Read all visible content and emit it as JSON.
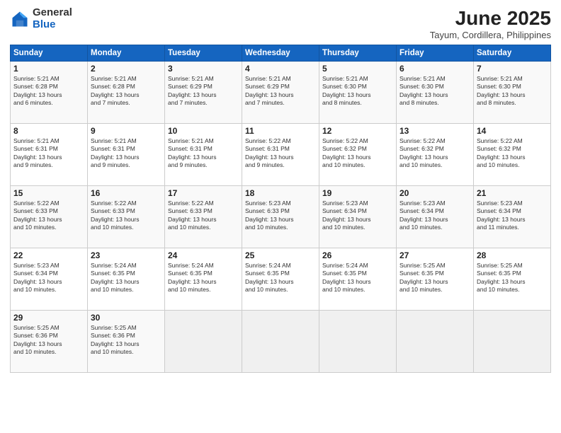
{
  "header": {
    "logo_general": "General",
    "logo_blue": "Blue",
    "title": "June 2025",
    "subtitle": "Tayum, Cordillera, Philippines"
  },
  "weekdays": [
    "Sunday",
    "Monday",
    "Tuesday",
    "Wednesday",
    "Thursday",
    "Friday",
    "Saturday"
  ],
  "weeks": [
    [
      {
        "day": "1",
        "lines": [
          "Sunrise: 5:21 AM",
          "Sunset: 6:28 PM",
          "Daylight: 13 hours",
          "and 6 minutes."
        ]
      },
      {
        "day": "2",
        "lines": [
          "Sunrise: 5:21 AM",
          "Sunset: 6:28 PM",
          "Daylight: 13 hours",
          "and 7 minutes."
        ]
      },
      {
        "day": "3",
        "lines": [
          "Sunrise: 5:21 AM",
          "Sunset: 6:29 PM",
          "Daylight: 13 hours",
          "and 7 minutes."
        ]
      },
      {
        "day": "4",
        "lines": [
          "Sunrise: 5:21 AM",
          "Sunset: 6:29 PM",
          "Daylight: 13 hours",
          "and 7 minutes."
        ]
      },
      {
        "day": "5",
        "lines": [
          "Sunrise: 5:21 AM",
          "Sunset: 6:30 PM",
          "Daylight: 13 hours",
          "and 8 minutes."
        ]
      },
      {
        "day": "6",
        "lines": [
          "Sunrise: 5:21 AM",
          "Sunset: 6:30 PM",
          "Daylight: 13 hours",
          "and 8 minutes."
        ]
      },
      {
        "day": "7",
        "lines": [
          "Sunrise: 5:21 AM",
          "Sunset: 6:30 PM",
          "Daylight: 13 hours",
          "and 8 minutes."
        ]
      }
    ],
    [
      {
        "day": "8",
        "lines": [
          "Sunrise: 5:21 AM",
          "Sunset: 6:31 PM",
          "Daylight: 13 hours",
          "and 9 minutes."
        ]
      },
      {
        "day": "9",
        "lines": [
          "Sunrise: 5:21 AM",
          "Sunset: 6:31 PM",
          "Daylight: 13 hours",
          "and 9 minutes."
        ]
      },
      {
        "day": "10",
        "lines": [
          "Sunrise: 5:21 AM",
          "Sunset: 6:31 PM",
          "Daylight: 13 hours",
          "and 9 minutes."
        ]
      },
      {
        "day": "11",
        "lines": [
          "Sunrise: 5:22 AM",
          "Sunset: 6:31 PM",
          "Daylight: 13 hours",
          "and 9 minutes."
        ]
      },
      {
        "day": "12",
        "lines": [
          "Sunrise: 5:22 AM",
          "Sunset: 6:32 PM",
          "Daylight: 13 hours",
          "and 10 minutes."
        ]
      },
      {
        "day": "13",
        "lines": [
          "Sunrise: 5:22 AM",
          "Sunset: 6:32 PM",
          "Daylight: 13 hours",
          "and 10 minutes."
        ]
      },
      {
        "day": "14",
        "lines": [
          "Sunrise: 5:22 AM",
          "Sunset: 6:32 PM",
          "Daylight: 13 hours",
          "and 10 minutes."
        ]
      }
    ],
    [
      {
        "day": "15",
        "lines": [
          "Sunrise: 5:22 AM",
          "Sunset: 6:33 PM",
          "Daylight: 13 hours",
          "and 10 minutes."
        ]
      },
      {
        "day": "16",
        "lines": [
          "Sunrise: 5:22 AM",
          "Sunset: 6:33 PM",
          "Daylight: 13 hours",
          "and 10 minutes."
        ]
      },
      {
        "day": "17",
        "lines": [
          "Sunrise: 5:22 AM",
          "Sunset: 6:33 PM",
          "Daylight: 13 hours",
          "and 10 minutes."
        ]
      },
      {
        "day": "18",
        "lines": [
          "Sunrise: 5:23 AM",
          "Sunset: 6:33 PM",
          "Daylight: 13 hours",
          "and 10 minutes."
        ]
      },
      {
        "day": "19",
        "lines": [
          "Sunrise: 5:23 AM",
          "Sunset: 6:34 PM",
          "Daylight: 13 hours",
          "and 10 minutes."
        ]
      },
      {
        "day": "20",
        "lines": [
          "Sunrise: 5:23 AM",
          "Sunset: 6:34 PM",
          "Daylight: 13 hours",
          "and 10 minutes."
        ]
      },
      {
        "day": "21",
        "lines": [
          "Sunrise: 5:23 AM",
          "Sunset: 6:34 PM",
          "Daylight: 13 hours",
          "and 11 minutes."
        ]
      }
    ],
    [
      {
        "day": "22",
        "lines": [
          "Sunrise: 5:23 AM",
          "Sunset: 6:34 PM",
          "Daylight: 13 hours",
          "and 10 minutes."
        ]
      },
      {
        "day": "23",
        "lines": [
          "Sunrise: 5:24 AM",
          "Sunset: 6:35 PM",
          "Daylight: 13 hours",
          "and 10 minutes."
        ]
      },
      {
        "day": "24",
        "lines": [
          "Sunrise: 5:24 AM",
          "Sunset: 6:35 PM",
          "Daylight: 13 hours",
          "and 10 minutes."
        ]
      },
      {
        "day": "25",
        "lines": [
          "Sunrise: 5:24 AM",
          "Sunset: 6:35 PM",
          "Daylight: 13 hours",
          "and 10 minutes."
        ]
      },
      {
        "day": "26",
        "lines": [
          "Sunrise: 5:24 AM",
          "Sunset: 6:35 PM",
          "Daylight: 13 hours",
          "and 10 minutes."
        ]
      },
      {
        "day": "27",
        "lines": [
          "Sunrise: 5:25 AM",
          "Sunset: 6:35 PM",
          "Daylight: 13 hours",
          "and 10 minutes."
        ]
      },
      {
        "day": "28",
        "lines": [
          "Sunrise: 5:25 AM",
          "Sunset: 6:35 PM",
          "Daylight: 13 hours",
          "and 10 minutes."
        ]
      }
    ],
    [
      {
        "day": "29",
        "lines": [
          "Sunrise: 5:25 AM",
          "Sunset: 6:36 PM",
          "Daylight: 13 hours",
          "and 10 minutes."
        ]
      },
      {
        "day": "30",
        "lines": [
          "Sunrise: 5:25 AM",
          "Sunset: 6:36 PM",
          "Daylight: 13 hours",
          "and 10 minutes."
        ]
      },
      {
        "day": "",
        "lines": []
      },
      {
        "day": "",
        "lines": []
      },
      {
        "day": "",
        "lines": []
      },
      {
        "day": "",
        "lines": []
      },
      {
        "day": "",
        "lines": []
      }
    ]
  ]
}
